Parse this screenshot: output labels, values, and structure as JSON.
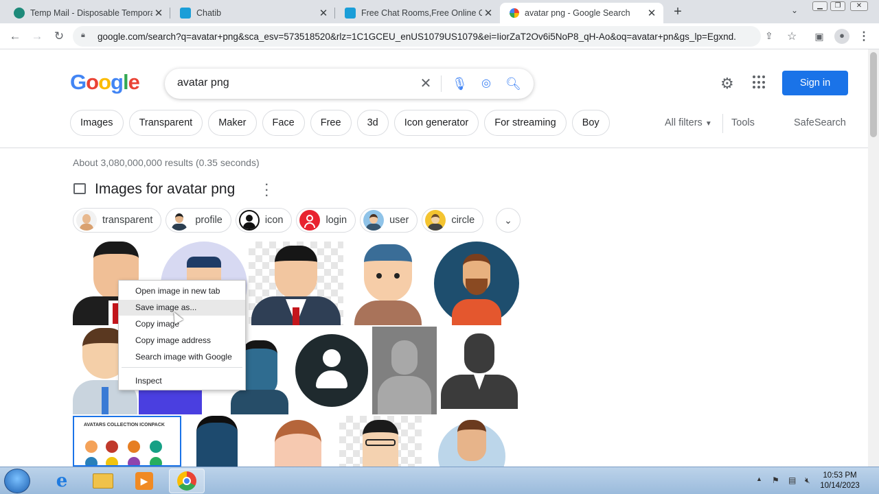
{
  "browser": {
    "tabs": [
      {
        "title": "Temp Mail - Disposable Tempora",
        "favicon_color": "#1e8a7a"
      },
      {
        "title": "Chatib",
        "favicon_color": "#1a9ed8"
      },
      {
        "title": "Free Chat Rooms,Free Online Ch",
        "favicon_color": "#1a9ed8"
      },
      {
        "title": "avatar png - Google Search",
        "favicon_color": "#4285f4",
        "active": true
      }
    ],
    "url": "google.com/search?q=avatar+png&sca_esv=573518520&rlz=1C1GCEU_enUS1079US1079&ei=IiorZaT2Ov6i5NoP8_qH-Ao&oq=avatar+pn&gs_lp=Egxnd..."
  },
  "google": {
    "logo": "Google",
    "query": "avatar png",
    "signin": "Sign in",
    "chips": [
      "Images",
      "Transparent",
      "Maker",
      "Face",
      "Free",
      "3d",
      "Icon generator",
      "For streaming",
      "Boy"
    ],
    "all_filters": "All filters",
    "tools": "Tools",
    "safesearch": "SafeSearch",
    "stats": "About 3,080,000,000 results (0.35 seconds)",
    "images_title": "Images for avatar png",
    "refine": [
      "transparent",
      "profile",
      "icon",
      "login",
      "user",
      "circle"
    ]
  },
  "context_menu": {
    "items": [
      "Open image in new tab",
      "Save image as...",
      "Copy image",
      "Copy image address",
      "Search image with Google"
    ],
    "inspect": "Inspect",
    "highlighted_index": 1
  },
  "taskbar": {
    "time": "10:53 PM",
    "date": "10/14/2023"
  },
  "colors": {
    "accent": "#1a73e8",
    "google_blue": "#4285f4",
    "google_red": "#ea4335",
    "google_yellow": "#fbbc05",
    "google_green": "#34a853"
  }
}
